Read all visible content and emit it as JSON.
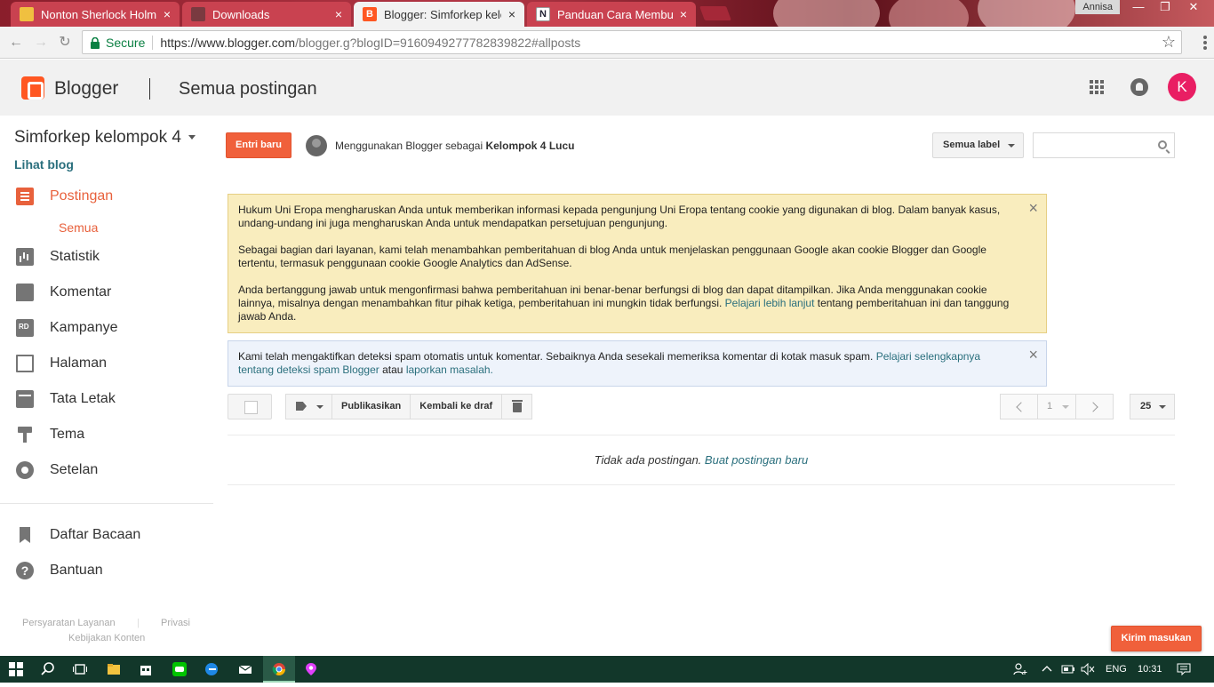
{
  "browser": {
    "tabs": [
      {
        "title": "Nonton Sherlock Holmes",
        "favicon": "sherlock-favicon",
        "active": false
      },
      {
        "title": "Downloads",
        "favicon": "downloads-favicon",
        "active": false
      },
      {
        "title": "Blogger: Simforkep kelom",
        "favicon": "blogger-favicon",
        "active": true
      },
      {
        "title": "Panduan Cara Membuat",
        "favicon": "notion-favicon",
        "active": false
      }
    ],
    "tab_close": "×",
    "profile": "Annisa",
    "secure_label": "Secure",
    "url_host": "https://www.blogger.com",
    "url_rest": "/blogger.g?blogID=9160949277782839822#allposts",
    "bookmark_star": "☆"
  },
  "header": {
    "brand": "Blogger",
    "page_title": "Semua postingan",
    "avatar_letter": "K",
    "avatar_color": "#e91e63"
  },
  "sidebar": {
    "blog_name": "Simforkep kelompok 4",
    "view_blog": "Lihat blog",
    "items": [
      {
        "label": "Postingan",
        "icon": "posts-icon"
      },
      {
        "label": "Statistik",
        "icon": "stats-icon"
      },
      {
        "label": "Komentar",
        "icon": "comment-icon"
      },
      {
        "label": "Kampanye",
        "icon": "ads-icon"
      },
      {
        "label": "Halaman",
        "icon": "pages-icon"
      },
      {
        "label": "Tata Letak",
        "icon": "layout-icon"
      },
      {
        "label": "Tema",
        "icon": "theme-icon"
      },
      {
        "label": "Setelan",
        "icon": "gear-icon"
      }
    ],
    "sub_item": "Semua",
    "secondary": [
      {
        "label": "Daftar Bacaan",
        "icon": "bookmark-icon"
      },
      {
        "label": "Bantuan",
        "icon": "help-icon"
      }
    ],
    "footer": {
      "terms": "Persyaratan Layanan",
      "privacy": "Privasi",
      "content_policy": "Kebijakan Konten"
    }
  },
  "main": {
    "new_post": "Entri baru",
    "using_prefix": "Menggunakan Blogger sebagai",
    "using_name": "Kelompok 4 Lucu",
    "label_filter": "Semua label",
    "cookie_notice": {
      "p1": "Hukum Uni Eropa mengharuskan Anda untuk memberikan informasi kepada pengunjung Uni Eropa tentang cookie yang digunakan di blog. Dalam banyak kasus, undang-undang ini juga mengharuskan Anda untuk mendapatkan persetujuan pengunjung.",
      "p2": "Sebagai bagian dari layanan, kami telah menambahkan pemberitahuan di blog Anda untuk menjelaskan penggunaan Google akan cookie Blogger dan Google tertentu, termasuk penggunaan cookie Google Analytics dan AdSense.",
      "p3": "Anda bertanggung jawab untuk mengonfirmasi bahwa pemberitahuan ini benar-benar berfungsi di blog dan dapat ditampilkan. Jika Anda menggunakan cookie lainnya, misalnya dengan menambahkan fitur pihak ketiga, pemberitahuan ini mungkin tidak berfungsi.",
      "link": "Pelajari lebih lanjut",
      "p3_tail": "tentang pemberitahuan ini dan tanggung jawab Anda."
    },
    "spam_notice": {
      "text": "Kami telah mengaktifkan deteksi spam otomatis untuk komentar. Sebaiknya Anda sesekali memeriksa komentar di kotak masuk spam.",
      "link1": "Pelajari selengkapnya tentang deteksi spam Blogger",
      "mid": "atau",
      "link2": "laporkan masalah."
    },
    "close": "×",
    "actions": {
      "publish": "Publikasikan",
      "revert": "Kembali ke draf"
    },
    "page_number": "1",
    "per_page": "25",
    "empty_text": "Tidak ada postingan.",
    "empty_link": "Buat postingan baru",
    "feedback": "Kirim masukan"
  },
  "taskbar": {
    "language": "ENG",
    "time": "10:31"
  },
  "colors": {
    "accent": "#f0603b",
    "link": "#2a6f7d",
    "yellow_notice": "#f9edbe",
    "blue_notice": "#eef3fb"
  }
}
